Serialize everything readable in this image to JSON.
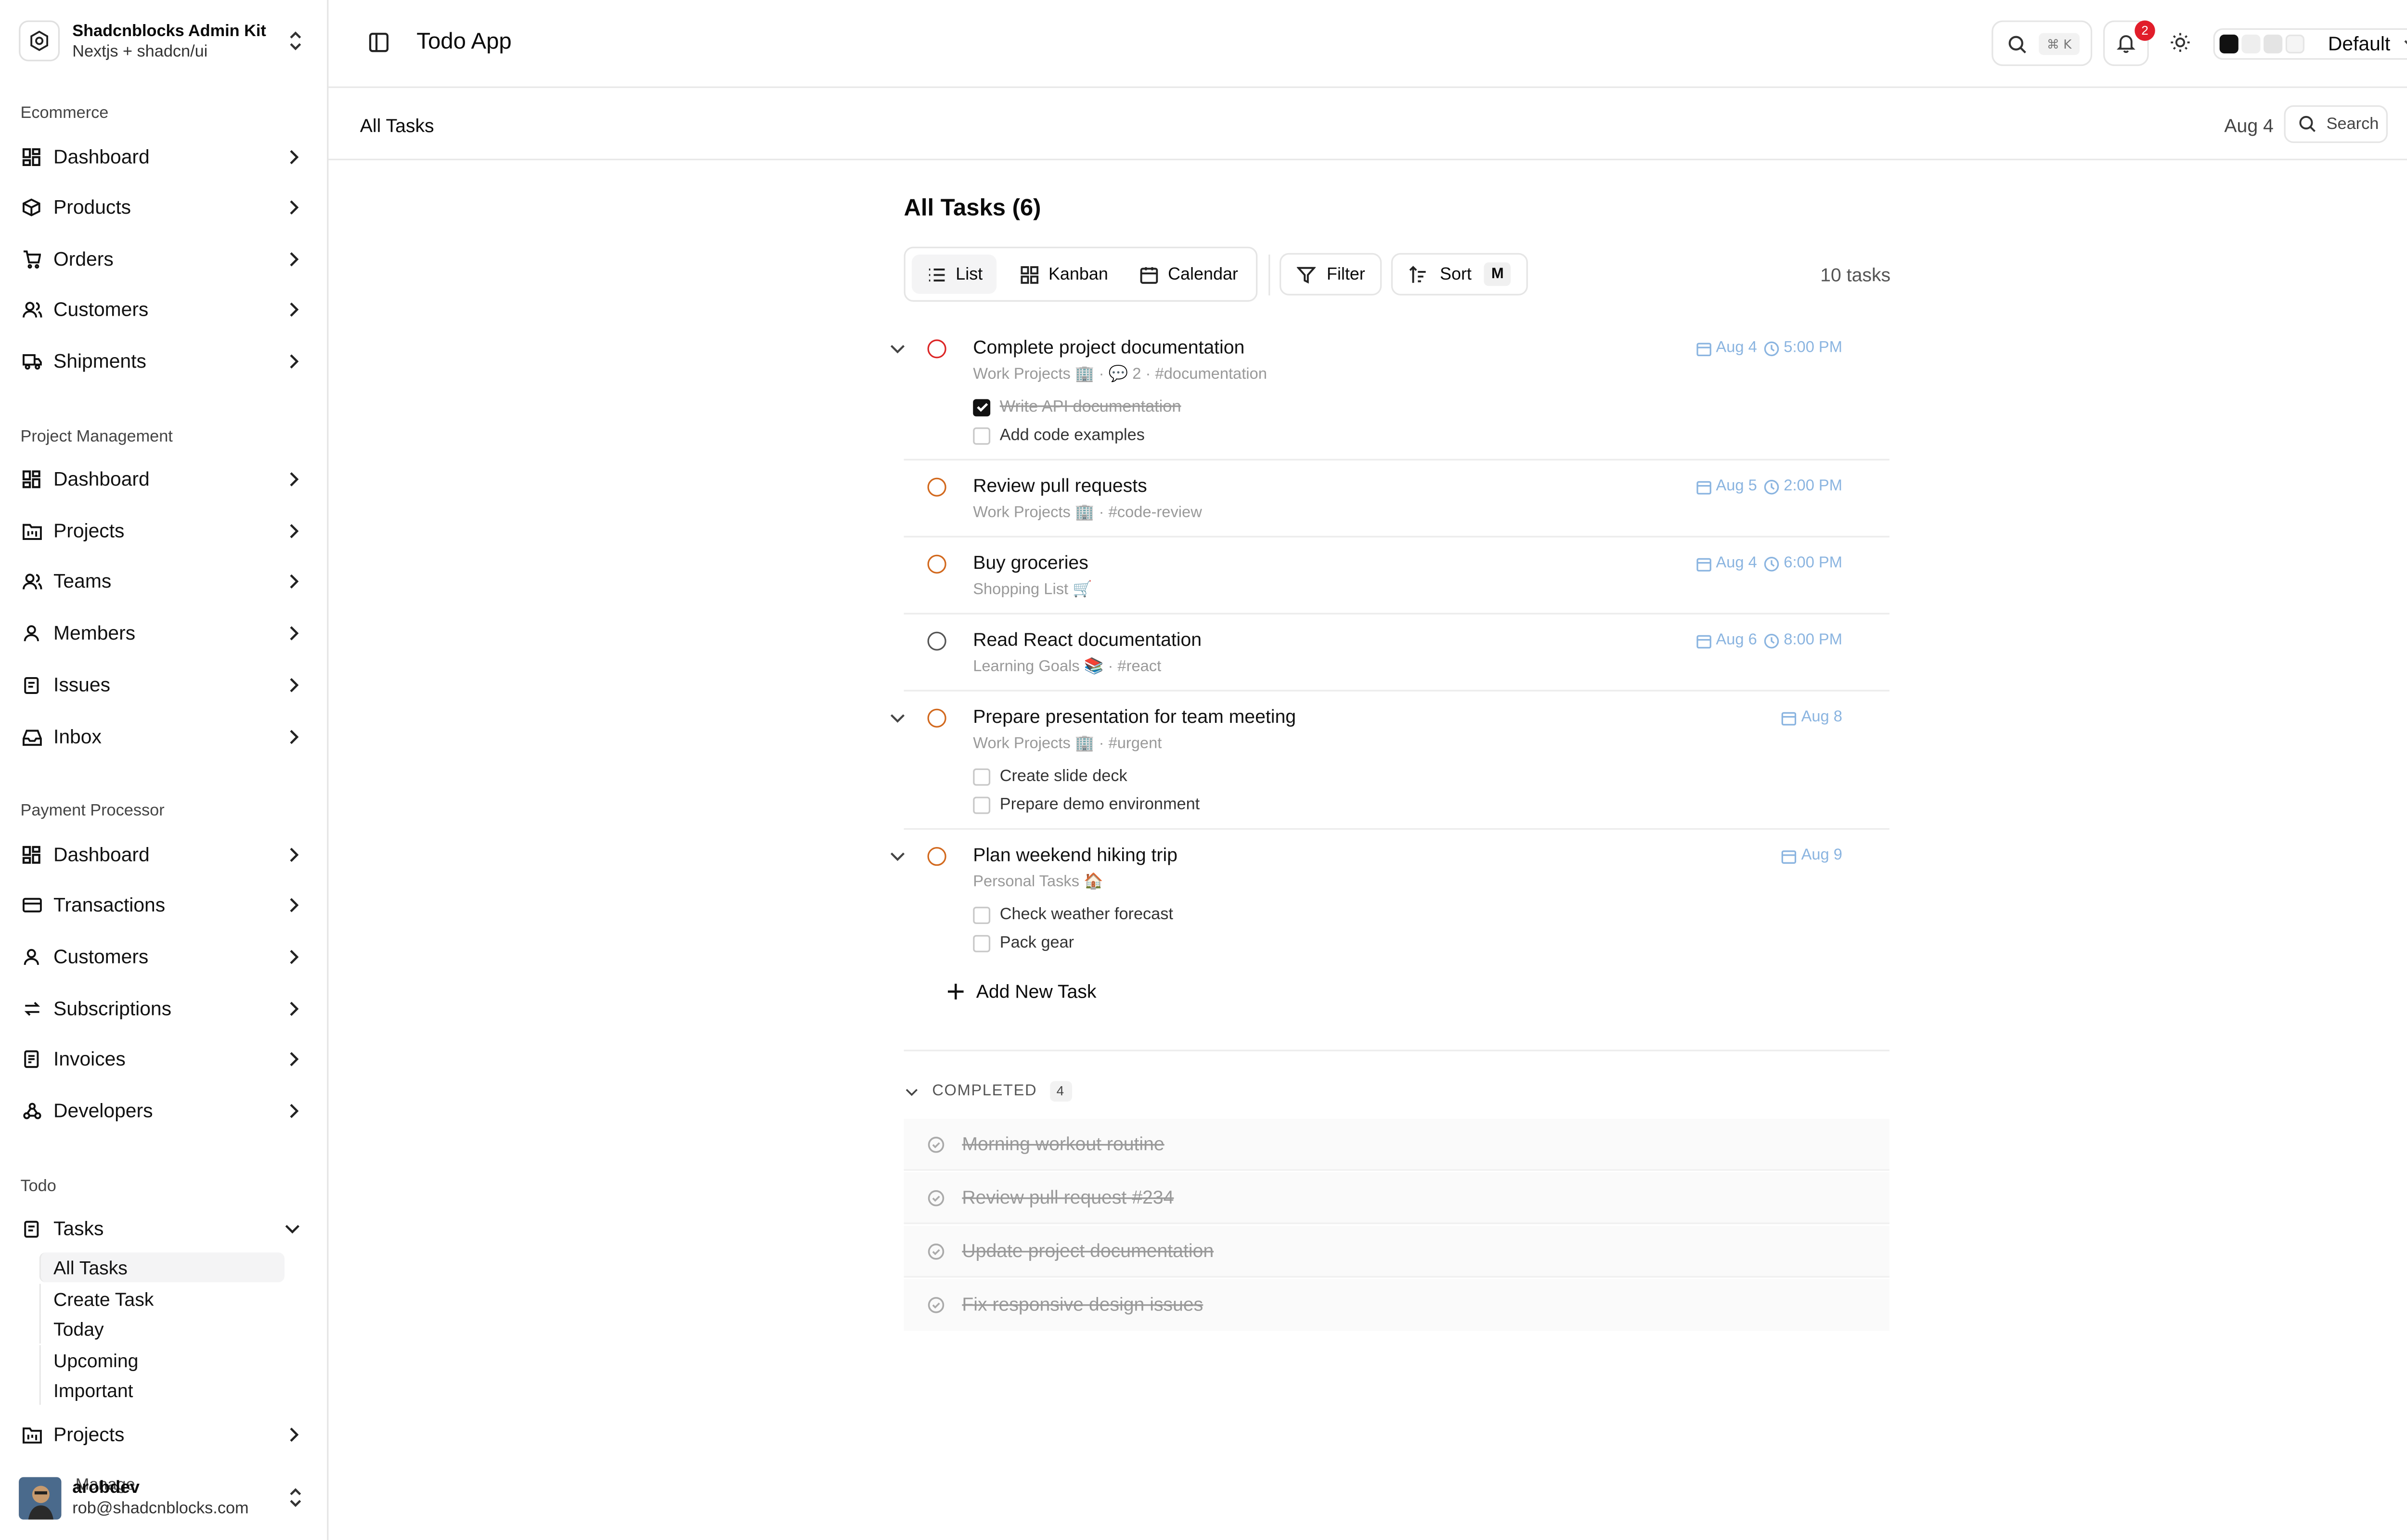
{
  "sidebar": {
    "brand_title": "Shadcnblocks Admin Kit",
    "brand_subtitle": "Nextjs + shadcn/ui",
    "sections": [
      {
        "title": "Ecommerce",
        "items": [
          "Dashboard",
          "Products",
          "Orders",
          "Customers",
          "Shipments"
        ]
      },
      {
        "title": "Project Management",
        "items": [
          "Dashboard",
          "Projects",
          "Teams",
          "Members",
          "Issues",
          "Inbox"
        ]
      },
      {
        "title": "Payment Processor",
        "items": [
          "Dashboard",
          "Transactions",
          "Customers",
          "Subscriptions",
          "Invoices",
          "Developers"
        ]
      },
      {
        "title": "Todo",
        "items": [
          "Tasks",
          "Projects"
        ]
      }
    ],
    "tasks_sub": [
      "All Tasks",
      "Create Task",
      "Today",
      "Upcoming",
      "Important"
    ],
    "overlap_text": "Manage",
    "user": {
      "name": "arobdev",
      "email": "rob@shadcnblocks.com"
    }
  },
  "topbar": {
    "title": "Todo App",
    "kbd": "⌘ K",
    "notifications": "2",
    "theme": "Default",
    "theme_colors": [
      "#111111",
      "#eeeeee",
      "#e4e4e4",
      "#f5f5f5"
    ]
  },
  "subbar": {
    "crumb": "All Tasks",
    "date": "Aug 4",
    "search": "Search"
  },
  "main": {
    "heading": "All Tasks (6)",
    "views": [
      "List",
      "Kanban",
      "Calendar"
    ],
    "filter": "Filter",
    "sort": "Sort",
    "sort_kbd": "M",
    "count": "10 tasks",
    "add_task": "Add New Task",
    "tasks": [
      {
        "title": "Complete project documentation",
        "meta": "Work Projects 🏢 · 💬 2 · #documentation",
        "date": "Aug 4",
        "time": "5:00 PM",
        "priority_color": "#dc2626",
        "subtasks": [
          {
            "label": "Write API documentation",
            "done": true
          },
          {
            "label": "Add code examples",
            "done": false
          }
        ]
      },
      {
        "title": "Review pull requests",
        "meta": "Work Projects 🏢 · #code-review",
        "date": "Aug 5",
        "time": "2:00 PM",
        "priority_color": "#e08a1e",
        "subtasks": []
      },
      {
        "title": "Buy groceries",
        "meta": "Shopping List 🛒",
        "date": "Aug 4",
        "time": "6:00 PM",
        "priority_color": "#e08a1e",
        "subtasks": []
      },
      {
        "title": "Read React documentation",
        "meta": "Learning Goals 📚 · #react",
        "date": "Aug 6",
        "time": "8:00 PM",
        "priority_color": "#555555",
        "subtasks": []
      },
      {
        "title": "Prepare presentation for team meeting",
        "meta": "Work Projects 🏢 · #urgent",
        "date": "Aug 8",
        "time": "",
        "priority_color": "#e08a1e",
        "subtasks": [
          {
            "label": "Create slide deck",
            "done": false
          },
          {
            "label": "Prepare demo environment",
            "done": false
          }
        ]
      },
      {
        "title": "Plan weekend hiking trip",
        "meta": "Personal Tasks 🏠",
        "date": "Aug 9",
        "time": "",
        "priority_color": "#e08a1e",
        "subtasks": [
          {
            "label": "Check weather forecast",
            "done": false
          },
          {
            "label": "Pack gear",
            "done": false
          }
        ]
      }
    ],
    "completed_label": "COMPLETED",
    "completed_count": "4",
    "completed": [
      "Morning workout routine",
      "Review pull request #234",
      "Update project documentation",
      "Fix responsive design issues"
    ]
  }
}
